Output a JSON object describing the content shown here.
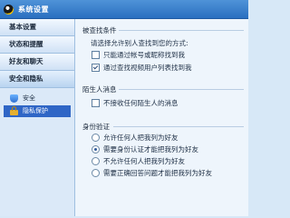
{
  "window": {
    "title": "系统设置"
  },
  "sidebar": {
    "sections": [
      {
        "label": "基本设置"
      },
      {
        "label": "状态和提醒"
      },
      {
        "label": "好友和聊天"
      },
      {
        "label": "安全和隐私"
      }
    ],
    "items": [
      {
        "label": "安全",
        "icon": "shield-icon"
      },
      {
        "label": "隐私保护",
        "icon": "lock-icon",
        "selected": true
      }
    ]
  },
  "find": {
    "title": "被查找条件",
    "description": "请选择允许别人查找到您的方式:",
    "options": [
      {
        "label": "只能通过帐号或昵称找到我",
        "checked": false
      },
      {
        "label": "通过查找视频用户列表找到我",
        "checked": true
      }
    ]
  },
  "stranger": {
    "title": "陌生人消息",
    "options": [
      {
        "label": "不接收任何陌生人的消息",
        "checked": false
      }
    ]
  },
  "auth": {
    "title": "身份验证",
    "options": [
      {
        "label": "允许任何人把我列为好友",
        "checked": false
      },
      {
        "label": "需要身份认证才能把我列为好友",
        "checked": true
      },
      {
        "label": "不允许任何人把我列为好友",
        "checked": false
      },
      {
        "label": "需要正确回答问题才能把我列为好友",
        "checked": false
      }
    ]
  }
}
